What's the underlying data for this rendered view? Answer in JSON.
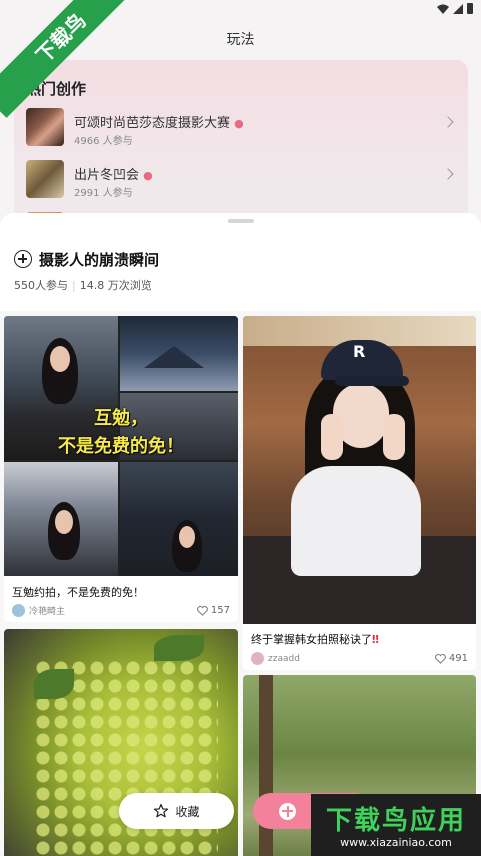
{
  "header": {
    "title": "玩法"
  },
  "hot": {
    "title": "热门创作",
    "items": [
      {
        "name": "可颂时尚芭莎态度摄影大赛",
        "meta": "4966 人参与"
      },
      {
        "name": "出片冬凹会",
        "meta": "2991 人参与"
      }
    ]
  },
  "topic": {
    "title": "摄影人的崩溃瞬间",
    "participants": "550人参与",
    "views": "14.8 万次浏览"
  },
  "cards": [
    {
      "overlay_line1": "互勉，",
      "overlay_line2": "不是免费的免！",
      "title": "互勉约拍，不是免费的免！",
      "author": "冷艳畸主",
      "likes": "157"
    },
    {
      "title": "终于掌握韩女拍照秘诀了",
      "title_mark": "‼",
      "author": "zzaadd",
      "likes": "491",
      "cap_letter": "R"
    }
  ],
  "buttons": {
    "collect": "收藏"
  },
  "watermark": {
    "ribbon": "下载鸟",
    "main": "下载鸟应用",
    "url": "www.xiazainiao.com"
  },
  "colors": {
    "accent_pink": "#f3819c",
    "watermark_green": "#26a04a"
  }
}
